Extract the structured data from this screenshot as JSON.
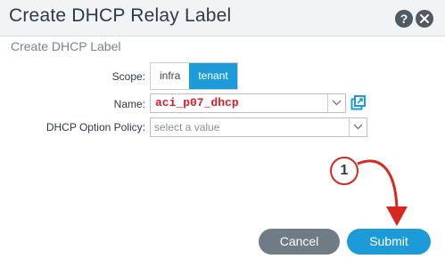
{
  "dialog": {
    "title": "Create DHCP Relay Label",
    "help_icon": "?",
    "icons": {
      "help": "question-circle-icon",
      "close": "close-circle-icon",
      "open_new": "open-in-new-window-icon",
      "dropdown": "chevron-down-icon"
    }
  },
  "form": {
    "section_title": "Create DHCP Label",
    "scope": {
      "label": "Scope:",
      "options": [
        "infra",
        "tenant"
      ],
      "selected": "tenant"
    },
    "name": {
      "label": "Name:",
      "value": "aci_p07_dhcp"
    },
    "policy": {
      "label": "DHCP Option Policy:",
      "placeholder": "select a value"
    }
  },
  "annotation": {
    "step_number": "1",
    "color": "#d6281e"
  },
  "footer": {
    "cancel_label": "Cancel",
    "submit_label": "Submit"
  },
  "colors": {
    "accent": "#1d9bd8",
    "cancel": "#6f7b85",
    "name_text": "#d81f26"
  }
}
